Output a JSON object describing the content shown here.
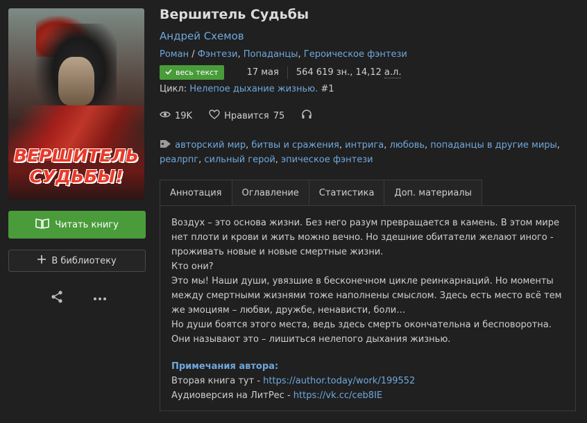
{
  "cover": {
    "line1": "ВЕРШИТЕЛЬ",
    "line2": "СУДЬБЫ!"
  },
  "actions": {
    "read_label": "Читать книгу",
    "library_label": "В библиотеку"
  },
  "book": {
    "title": "Вершитель Судьбы",
    "author": "Андрей Схемов",
    "genres": {
      "type": "Роман",
      "list": [
        "Фэнтези",
        "Попаданцы",
        "Героическое фэнтези"
      ]
    },
    "status_badge": "весь текст",
    "date": "17 мая",
    "size": "564 619 зн., 14,12",
    "size_unit": "а.л.",
    "cycle_label": "Цикл:",
    "cycle_name": "Нелепое дыхание жизнью.",
    "cycle_num": "#1",
    "views": "19K",
    "likes_label": "Нравится",
    "likes": "75",
    "tags": [
      "авторский мир",
      "битвы и сражения",
      "интрига",
      "любовь",
      "попаданцы в другие миры",
      "реалрпг",
      "сильный герой",
      "эпическое фэнтези"
    ]
  },
  "tabs": [
    "Аннотация",
    "Оглавление",
    "Статистика",
    "Доп. материалы"
  ],
  "annotation": {
    "lines": [
      "Воздух – это основа жизни. Без него разум превращается в камень. В этом мире нет плоти и крови и жить можно вечно. Но здешние обитатели желают иного - проживать новые и новые смертные жизни.",
      "Кто они?",
      "Это мы! Наши души, увязшие в бесконечном цикле реинкарнаций. Но моменты между смертными жизнями тоже наполнены смыслом. Здесь есть место всё тем же эмоциям – любви, дружбе, ненависти, боли…",
      "Но души боятся этого места, ведь здесь смерть окончательна и бесповоротна. Они называют это – лишиться нелепого дыхания жизнью."
    ],
    "notes_heading": "Примечания автора:",
    "note1_text": "Вторая книга тут - ",
    "note1_link": "https://author.today/work/199552",
    "note2_text": "Аудиоверсия на ЛитРес - ",
    "note2_link": "https://vk.cc/ceb8IE"
  },
  "colors": {
    "accent_green": "#4a9c3b",
    "link_blue": "#6fa8dc",
    "background": "#202020"
  }
}
